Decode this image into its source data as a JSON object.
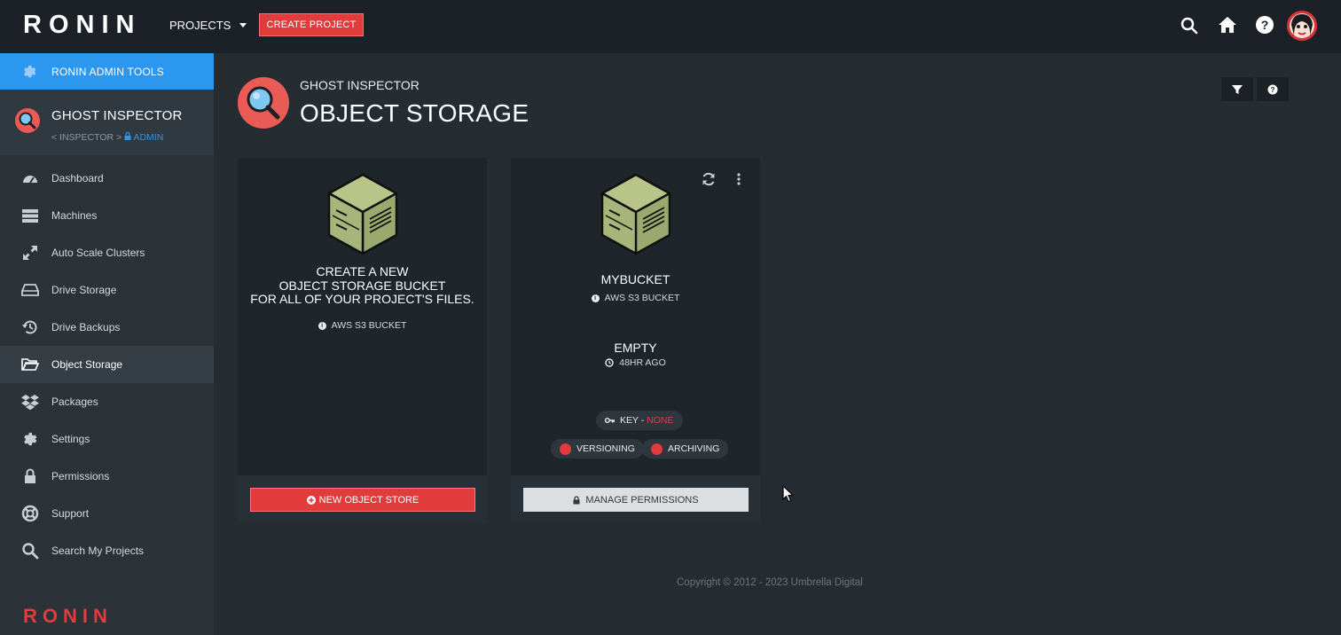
{
  "topbar": {
    "logo": "RONIN",
    "projects_label": "PROJECTS",
    "create_project_label": "CREATE PROJECT",
    "icons": [
      "search-icon",
      "home-icon",
      "help-icon",
      "avatar"
    ]
  },
  "sidebar": {
    "admin_tools_label": "RONIN ADMIN TOOLS",
    "project_name": "GHOST INSPECTOR",
    "crumb_prefix": "< INSPECTOR >",
    "crumb_admin": "ADMIN",
    "items": [
      {
        "label": "Dashboard",
        "icon": "dashboard-icon"
      },
      {
        "label": "Machines",
        "icon": "server-icon"
      },
      {
        "label": "Auto Scale Clusters",
        "icon": "expand-icon"
      },
      {
        "label": "Drive Storage",
        "icon": "hdd-icon"
      },
      {
        "label": "Drive Backups",
        "icon": "history-icon"
      },
      {
        "label": "Object Storage",
        "icon": "folder-open-icon",
        "active": true
      },
      {
        "label": "Packages",
        "icon": "dropbox-icon"
      },
      {
        "label": "Settings",
        "icon": "gear-icon"
      },
      {
        "label": "Permissions",
        "icon": "lock-icon"
      },
      {
        "label": "Support",
        "icon": "lifebuoy-icon"
      },
      {
        "label": "Search My Projects",
        "icon": "search-icon"
      }
    ],
    "brand_bottom": "RONIN"
  },
  "header": {
    "subtitle": "GHOST INSPECTOR",
    "title": "OBJECT STORAGE"
  },
  "create_card": {
    "line1": "CREATE A NEW",
    "line2": "OBJECT STORAGE BUCKET",
    "line3": "FOR ALL OF YOUR PROJECT'S FILES.",
    "type": "AWS S3 BUCKET",
    "button_label": "NEW OBJECT STORE"
  },
  "bucket_card": {
    "name": "MYBUCKET",
    "type": "AWS S3 BUCKET",
    "status": "EMPTY",
    "time": "48HR AGO",
    "key_label": "KEY - ",
    "key_value": "NONE",
    "versioning_label": "VERSIONING",
    "archiving_label": "ARCHIVING",
    "button_label": "MANAGE PERMISSIONS"
  },
  "footer": {
    "copyright": "Copyright © 2012 - 2023 Umbrella Digital"
  },
  "colors": {
    "accent_red": "#e23b3b",
    "accent_blue": "#2c97ee",
    "background": "#252d33",
    "sidebar": "#2b3339"
  }
}
